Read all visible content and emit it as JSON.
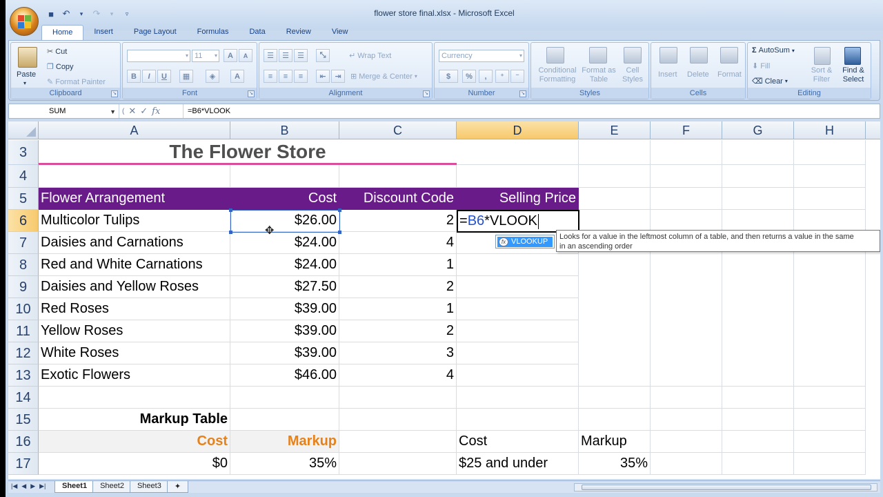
{
  "window": {
    "title": "flower store final.xlsx - Microsoft Excel"
  },
  "tabs": [
    "Home",
    "Insert",
    "Page Layout",
    "Formulas",
    "Data",
    "Review",
    "View"
  ],
  "ribbon": {
    "clipboard": {
      "label": "Clipboard",
      "paste": "Paste",
      "cut": "Cut",
      "copy": "Copy",
      "format_painter": "Format Painter"
    },
    "font": {
      "label": "Font",
      "size": "11",
      "bold": "B",
      "italic": "I",
      "underline": "U",
      "grow": "A",
      "shrink": "A",
      "color": "A"
    },
    "alignment": {
      "label": "Alignment",
      "wrap_text": "Wrap Text",
      "merge_center": "Merge & Center"
    },
    "number": {
      "label": "Number",
      "format": "Currency",
      "currency": "$",
      "percent": "%",
      "comma": ","
    },
    "styles": {
      "label": "Styles",
      "conditional": "Conditional Formatting",
      "format_table": "Format as Table",
      "cell_styles": "Cell Styles"
    },
    "cells": {
      "label": "Cells",
      "insert": "Insert",
      "delete": "Delete",
      "format": "Format"
    },
    "editing": {
      "label": "Editing",
      "autosum": "AutoSum",
      "fill": "Fill",
      "clear": "Clear",
      "sort_filter": "Sort & Filter",
      "find_select": "Find & Select"
    }
  },
  "formula_bar": {
    "name_box": "SUM",
    "cancel": "✕",
    "enter": "✓",
    "fx": "fx",
    "formula": "=B6*VLOOK"
  },
  "columns": [
    "A",
    "B",
    "C",
    "D",
    "E",
    "F",
    "G",
    "H"
  ],
  "rows": [
    "3",
    "4",
    "5",
    "6",
    "7",
    "8",
    "9",
    "10",
    "11",
    "12",
    "13",
    "14",
    "15",
    "16",
    "17"
  ],
  "sheet": {
    "title": "The Flower Store",
    "headers": {
      "arrangement": "Flower Arrangement",
      "cost": "Cost",
      "discount": "Discount Code",
      "price": "Selling Price"
    },
    "items": [
      {
        "name": "Multicolor Tulips",
        "cost": "$26.00",
        "code": "2"
      },
      {
        "name": "Daisies and Carnations",
        "cost": "$24.00",
        "code": "4"
      },
      {
        "name": "Red and White Carnations",
        "cost": "$24.00",
        "code": "1"
      },
      {
        "name": "Daisies and Yellow Roses",
        "cost": "$27.50",
        "code": "2"
      },
      {
        "name": "Red Roses",
        "cost": "$39.00",
        "code": "1"
      },
      {
        "name": "Yellow Roses",
        "cost": "$39.00",
        "code": "2"
      },
      {
        "name": "White Roses",
        "cost": "$39.00",
        "code": "3"
      },
      {
        "name": "Exotic Flowers",
        "cost": "$46.00",
        "code": "4"
      }
    ],
    "editing_cell": {
      "prefix": "=",
      "ref": "B6",
      "suffix": "*VLOOK"
    },
    "markup_table": {
      "title": "Markup Table",
      "cost_header": "Cost",
      "markup_header": "Markup",
      "row1_cost": "$0",
      "row1_markup": "35%"
    },
    "side_table": {
      "cost_header": "Cost",
      "markup_header": "Markup",
      "row1_cost": "$25 and under",
      "row1_markup": "35%"
    }
  },
  "autocomplete": {
    "item": "VLOOKUP",
    "icon": "fx"
  },
  "tooltip": {
    "line1": "Looks for a value in the leftmost column of a table, and then returns a value in the same",
    "line2": "in an ascending order"
  },
  "sheet_tabs": [
    "Sheet1",
    "Sheet2",
    "Sheet3"
  ],
  "colors": {
    "header_purple": "#6a1b8a",
    "accent_orange": "#e5821b",
    "title_underline": "#d94d9c"
  }
}
